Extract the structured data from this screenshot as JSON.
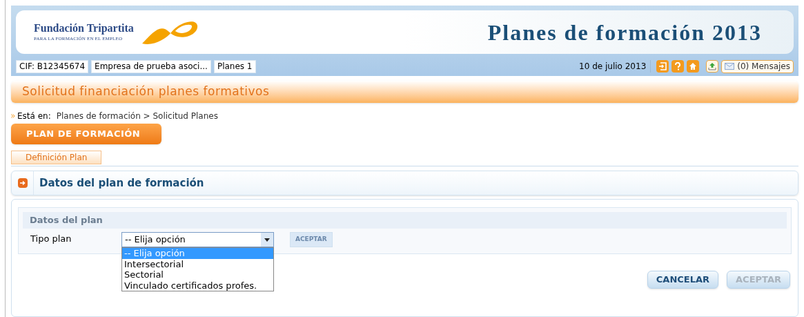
{
  "header": {
    "org_name": "Fundación Tripartita",
    "org_tagline": "PARA LA FORMACIÓN EN EL EMPLEO",
    "title": "Planes de formación 2013"
  },
  "info_tags": [
    "CIF: B12345674",
    "Empresa de prueba asoci...",
    "Planes 1"
  ],
  "date": "10 de julio 2013",
  "messages": "(0) Mensajes",
  "page_title": "Solicitud financiación planes formativos",
  "breadcrumb": {
    "label": "Está en:",
    "path": "Planes de formación > Solicitud Planes"
  },
  "section_button": "PLAN DE FORMACIÓN",
  "tabs": [
    {
      "label": "Definición Plan",
      "selected": true
    }
  ],
  "section_title": "Datos del plan de formación",
  "fieldset": {
    "legend": "Datos del plan",
    "field": {
      "label": "Tipo plan",
      "value": "-- Elija opción",
      "expanded": true,
      "options": [
        {
          "label": "-- Elija opción",
          "selected": true
        },
        {
          "label": "Intersectorial",
          "selected": false
        },
        {
          "label": "Sectorial",
          "selected": false
        },
        {
          "label": "Vinculado certificados profes.",
          "selected": false
        }
      ]
    },
    "button": {
      "label": "ACEPTAR",
      "disabled": false
    }
  },
  "buttons": [
    {
      "label": "CANCELAR",
      "disabled": false
    },
    {
      "label": "ACEPTAR",
      "disabled": true
    }
  ]
}
